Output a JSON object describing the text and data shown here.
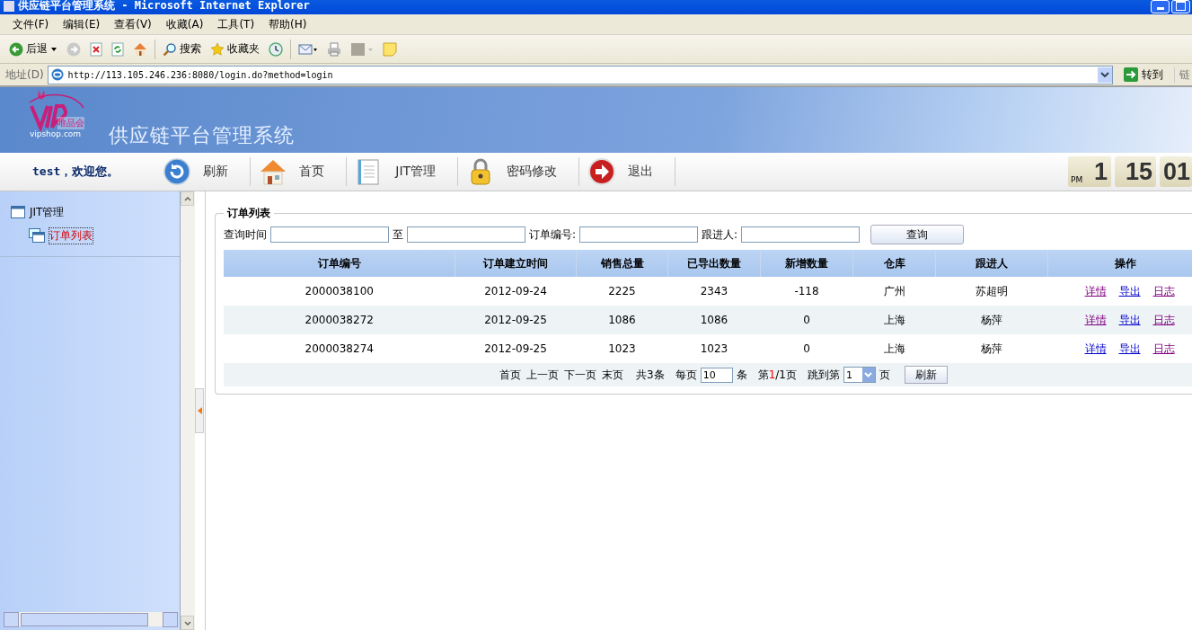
{
  "window": {
    "title": "供应链平台管理系统 - Microsoft Internet Explorer"
  },
  "menu": [
    "文件(F)",
    "编辑(E)",
    "查看(V)",
    "收藏(A)",
    "工具(T)",
    "帮助(H)"
  ],
  "toolbar": [
    {
      "kind": "back",
      "label": "后退"
    },
    {
      "kind": "forward"
    },
    {
      "kind": "stop"
    },
    {
      "kind": "refresh"
    },
    {
      "kind": "home"
    },
    {
      "kind": "search",
      "label": "搜索"
    },
    {
      "kind": "favorites",
      "label": "收藏夹"
    },
    {
      "kind": "history"
    },
    {
      "kind": "mail"
    },
    {
      "kind": "print"
    },
    {
      "kind": "edit"
    },
    {
      "kind": "note"
    }
  ],
  "address": {
    "label": "地址(D)",
    "value": "http://113.105.246.236:8080/login.do?method=login",
    "go": "转到",
    "links": "链"
  },
  "header": {
    "logo_text": "唯品会",
    "logo_url": "vipshop.com",
    "title": "供应链平台管理系统"
  },
  "nav": {
    "welcome": "test，欢迎您。",
    "items": [
      {
        "kind": "refresh",
        "label": "刷新"
      },
      {
        "kind": "home",
        "label": "首页"
      },
      {
        "kind": "doc",
        "label": "JIT管理"
      },
      {
        "kind": "lock",
        "label": "密码修改"
      },
      {
        "kind": "exit",
        "label": "退出"
      }
    ]
  },
  "clock": {
    "ampm": "PM",
    "hour": "1",
    "minute": "15",
    "second": "01"
  },
  "sidebar": {
    "items": [
      {
        "label": "JIT管理",
        "selected": false,
        "children": [
          {
            "label": "订单列表",
            "selected": true
          }
        ]
      }
    ]
  },
  "panel": {
    "title": "订单列表",
    "filters": [
      {
        "label": "查询时间"
      },
      {
        "label": "至"
      },
      {
        "label": "订单编号:"
      },
      {
        "label": "跟进人:"
      }
    ],
    "query_button": "查询",
    "table": {
      "columns": [
        "订单编号",
        "订单建立时间",
        "销售总量",
        "已导出数量",
        "新增数量",
        "仓库",
        "跟进人",
        "操作"
      ],
      "rows": [
        {
          "cells": [
            "2000038100",
            "2012-09-24",
            "2225",
            "2343",
            "-118",
            "广州",
            "苏超明"
          ],
          "links": [
            {
              "label": "详情",
              "visited": true
            },
            {
              "label": "导出",
              "visited": false
            },
            {
              "label": "日志",
              "visited": true
            }
          ]
        },
        {
          "cells": [
            "2000038272",
            "2012-09-25",
            "1086",
            "1086",
            "0",
            "上海",
            "杨萍"
          ],
          "links": [
            {
              "label": "详情",
              "visited": true
            },
            {
              "label": "导出",
              "visited": false
            },
            {
              "label": "日志",
              "visited": true
            }
          ]
        },
        {
          "cells": [
            "2000038274",
            "2012-09-25",
            "1023",
            "1023",
            "0",
            "上海",
            "杨萍"
          ],
          "links": [
            {
              "label": "详情",
              "visited": false
            },
            {
              "label": "导出",
              "visited": false
            },
            {
              "label": "日志",
              "visited": true
            }
          ]
        }
      ]
    },
    "pager": {
      "links": [
        "首页",
        "上一页",
        "下一页",
        "末页"
      ],
      "total": "共3条",
      "per_page_label": "每页",
      "per_page": "10",
      "per_page_unit": "条",
      "page_prefix": "第",
      "page_current": "1",
      "page_suffix": "/1页",
      "jump_label": "跳到第",
      "jump_value": "1",
      "jump_unit": "页",
      "refresh": "刷新"
    }
  }
}
